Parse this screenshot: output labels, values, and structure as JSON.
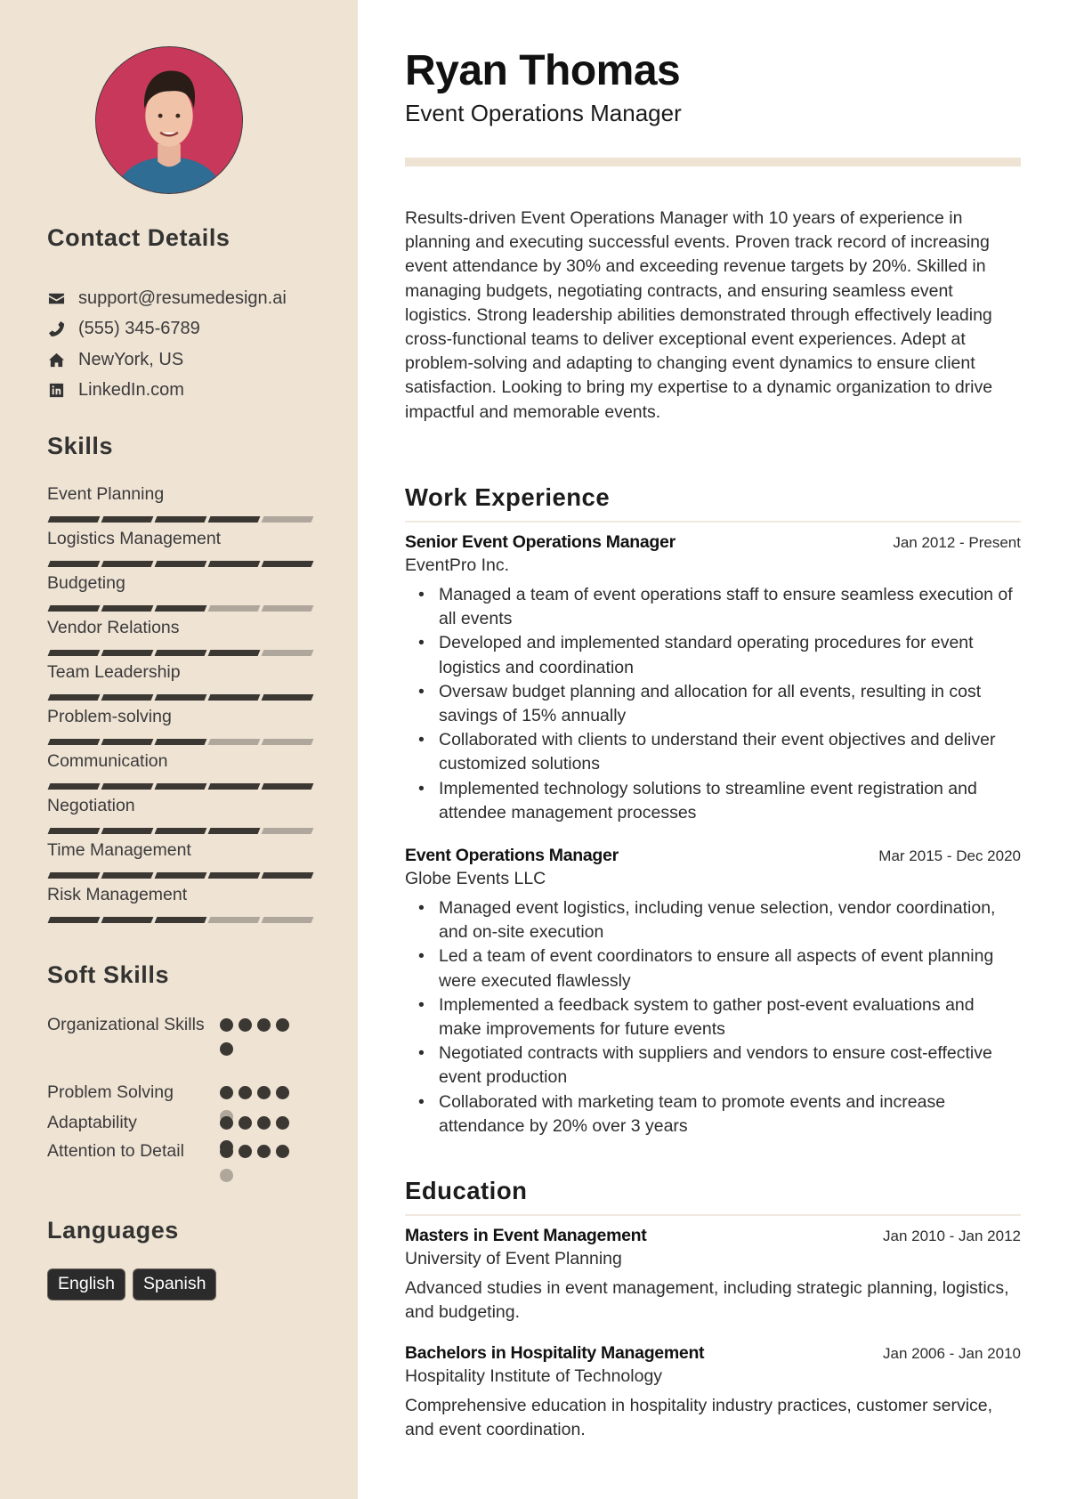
{
  "profile": {
    "name": "Ryan Thomas",
    "title": "Event Operations Manager",
    "photo": "portrait-photo"
  },
  "sidebar": {
    "contact": {
      "heading": "Contact Details",
      "items": [
        {
          "icon": "envelope-icon",
          "text": "support@resumedesign.ai"
        },
        {
          "icon": "phone-icon",
          "text": "(555) 345-6789"
        },
        {
          "icon": "home-icon",
          "text": "NewYork, US"
        },
        {
          "icon": "linkedin-icon",
          "text": "LinkedIn.com"
        }
      ]
    },
    "skills": {
      "heading": "Skills",
      "max": 5,
      "items": [
        {
          "label": "Event Planning",
          "level": 4
        },
        {
          "label": "Logistics Management",
          "level": 5
        },
        {
          "label": "Budgeting",
          "level": 3
        },
        {
          "label": "Vendor Relations",
          "level": 4
        },
        {
          "label": "Team Leadership",
          "level": 5
        },
        {
          "label": "Problem-solving",
          "level": 3
        },
        {
          "label": "Communication",
          "level": 5
        },
        {
          "label": "Negotiation",
          "level": 4
        },
        {
          "label": "Time Management",
          "level": 5
        },
        {
          "label": "Risk Management",
          "level": 3
        }
      ]
    },
    "soft_skills": {
      "heading": "Soft Skills",
      "max": 5,
      "items": [
        {
          "label": "Organizational Skills",
          "level": 5
        },
        {
          "label": "Problem Solving",
          "level": 4
        },
        {
          "label": "Adaptability",
          "level": 5
        },
        {
          "label": "Attention to Detail",
          "level": 4
        }
      ]
    },
    "languages": {
      "heading": "Languages",
      "items": [
        "English",
        "Spanish"
      ]
    }
  },
  "main": {
    "summary": "Results-driven Event Operations Manager with 10 years of experience in planning and executing successful events. Proven track record of increasing event attendance by 30% and exceeding revenue targets by 20%. Skilled in managing budgets, negotiating contracts, and ensuring seamless event logistics. Strong leadership abilities demonstrated through effectively leading cross-functional teams to deliver exceptional event experiences. Adept at problem-solving and adapting to changing event dynamics to ensure client satisfaction. Looking to bring my expertise to a dynamic organization to drive impactful and memorable events.",
    "work": {
      "heading": "Work Experience",
      "jobs": [
        {
          "title": "Senior Event Operations Manager",
          "company": "EventPro Inc.",
          "dates": "Jan 2012 - Present",
          "bullets": [
            "Managed a team of event operations staff to ensure seamless execution of all events",
            "Developed and implemented standard operating procedures for event logistics and coordination",
            "Oversaw budget planning and allocation for all events, resulting in cost savings of 15% annually",
            "Collaborated with clients to understand their event objectives and deliver customized solutions",
            "Implemented technology solutions to streamline event registration and attendee management processes"
          ]
        },
        {
          "title": "Event Operations Manager",
          "company": "Globe Events LLC",
          "dates": "Mar 2015 - Dec 2020",
          "bullets": [
            "Managed event logistics, including venue selection, vendor coordination, and on-site execution",
            "Led a team of event coordinators to ensure all aspects of event planning were executed flawlessly",
            "Implemented a feedback system to gather post-event evaluations and make improvements for future events",
            "Negotiated contracts with suppliers and vendors to ensure cost-effective event production",
            "Collaborated with marketing team to promote events and increase attendance by 20% over 3 years"
          ]
        }
      ]
    },
    "education": {
      "heading": "Education",
      "items": [
        {
          "degree": "Masters in Event Management",
          "school": "University of Event Planning",
          "dates": "Jan 2010 - Jan 2012",
          "description": "Advanced studies in event management, including strategic planning, logistics, and budgeting."
        },
        {
          "degree": "Bachelors in Hospitality Management",
          "school": "Hospitality Institute of Technology",
          "dates": "Jan 2006 - Jan 2010",
          "description": "Comprehensive education in hospitality industry practices, customer service, and event coordination."
        }
      ]
    }
  },
  "colors": {
    "sidebar_bg": "#efe3d4",
    "accent_dark": "#3b3733",
    "accent_light": "#b0a79c",
    "photo_bg": "#c8385a"
  }
}
